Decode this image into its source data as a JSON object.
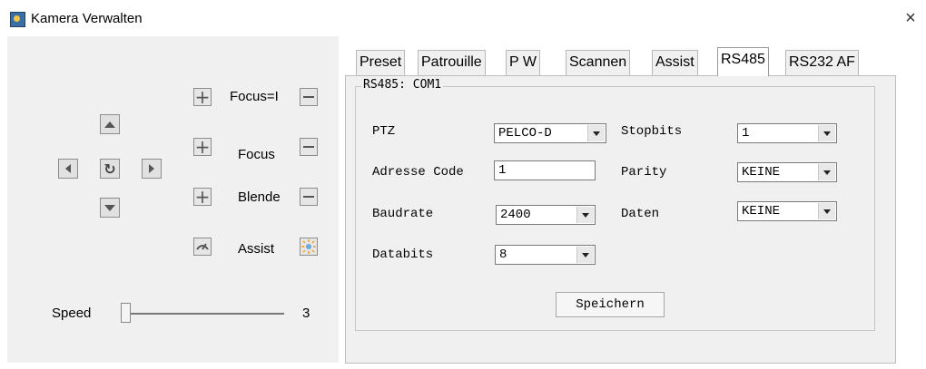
{
  "window": {
    "title": "Kamera Verwalten",
    "close_glyph": "×",
    "icon": "app-icon"
  },
  "controls": {
    "focus_near_label": "Focus=I",
    "focus_label": "Focus",
    "iris_label": "Blende",
    "assist_label": "Assist",
    "speed_label": "Speed",
    "speed_value": "3",
    "plus_glyph": "+",
    "reload_glyph": "↻"
  },
  "tabs": [
    {
      "label": "Preset"
    },
    {
      "label": "Patrouille"
    },
    {
      "label": "P  W"
    },
    {
      "label": "Scannen"
    },
    {
      "label": "Assist"
    },
    {
      "label": "RS485"
    },
    {
      "label": "RS232 AF"
    }
  ],
  "active_tab": "RS485",
  "rs485": {
    "group_title": "RS485: COM1",
    "ptz_label": "PTZ",
    "ptz_value": "PELCO-D",
    "address_label": "Adresse Code",
    "address_value": "1",
    "baud_label": "Baudrate",
    "baud_value": "2400",
    "databits_label": "Databits",
    "databits_value": "8",
    "stopbits_label": "Stopbits",
    "stopbits_value": "1",
    "parity_label": "Parity",
    "parity_value": "KEINE",
    "daten_label": "Daten",
    "daten_value": "KEINE",
    "save_label": "Speichern"
  }
}
